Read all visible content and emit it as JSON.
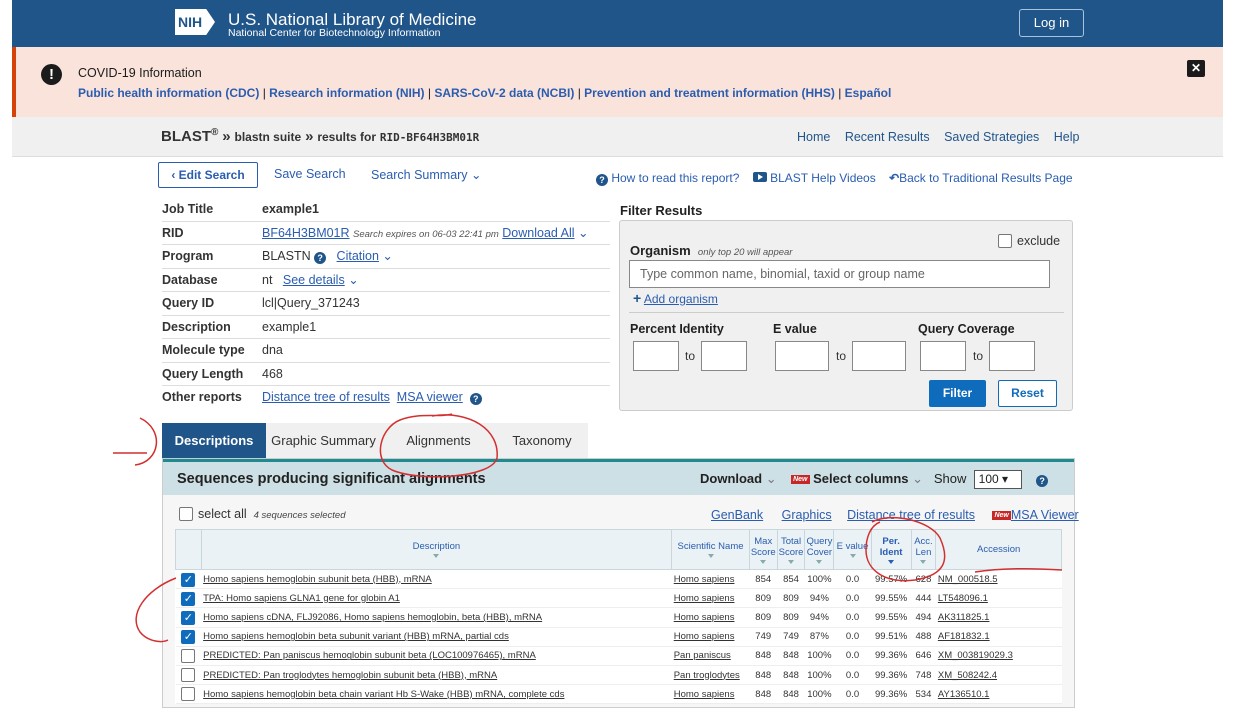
{
  "header": {
    "logo": "NIH",
    "title": "U.S. National Library of Medicine",
    "subtitle": "National Center for Biotechnology Information",
    "login": "Log in"
  },
  "covid": {
    "title": "COVID-19 Information",
    "links": [
      "Public health information (CDC)",
      "Research information (NIH)",
      "SARS-CoV-2 data (NCBI)",
      "Prevention and treatment information (HHS)",
      "Español"
    ],
    "sep": "|"
  },
  "breadcrumb": {
    "blast": "BLAST",
    "reg": "®",
    "sep1": "»",
    "suite": "blastn suite",
    "sep2": "»",
    "results_for": "results for",
    "rid": "RID-BF64H3BM01R"
  },
  "topnav": [
    "Home",
    "Recent Results",
    "Saved Strategies",
    "Help"
  ],
  "toolbar": {
    "edit": "‹ Edit Search",
    "save": "Save Search",
    "summary": "Search Summary",
    "how": "How to read this report?",
    "videos": "BLAST Help Videos",
    "back": "Back to Traditional Results Page"
  },
  "job": {
    "rows": [
      {
        "k": "Job Title",
        "v": "example1"
      },
      {
        "k": "RID",
        "v": "BF64H3BM01R",
        "note": "Search expires on 06-03 22:41 pm",
        "dl": "Download All"
      },
      {
        "k": "Program",
        "v": "BLASTN",
        "extra": "Citation"
      },
      {
        "k": "Database",
        "v": "nt",
        "extra": "See details"
      },
      {
        "k": "Query ID",
        "v": "lcl|Query_371243"
      },
      {
        "k": "Description",
        "v": "example1"
      },
      {
        "k": "Molecule type",
        "v": "dna"
      },
      {
        "k": "Query Length",
        "v": "468"
      },
      {
        "k": "Other reports",
        "v": "Distance tree of results",
        "extra": "MSA viewer"
      }
    ]
  },
  "filter": {
    "title": "Filter Results",
    "organism": "Organism",
    "note": "only top 20 will appear",
    "exclude": "exclude",
    "placeholder": "Type common  name, binomial, taxid or group  name",
    "add": "Add organism",
    "pct": "Percent Identity",
    "evalue": "E value",
    "qcov": "Query Coverage",
    "to": "to",
    "filter_btn": "Filter",
    "reset_btn": "Reset"
  },
  "tabs": [
    "Descriptions",
    "Graphic Summary",
    "Alignments",
    "Taxonomy"
  ],
  "results": {
    "title": "Sequences producing significant alignments",
    "download": "Download",
    "select_cols": "Select columns",
    "show": "Show",
    "show_val": "100",
    "new_badge": "New",
    "select_all": "select all",
    "selected": "4 sequences selected",
    "links": [
      "GenBank",
      "Graphics",
      "Distance tree of results",
      "MSA Viewer"
    ]
  },
  "columns": [
    "Description",
    "Scientific Name",
    "Max Score",
    "Total Score",
    "Query Cover",
    "E value",
    "Per. Ident",
    "Acc. Len",
    "Accession"
  ],
  "rows": [
    {
      "checked": true,
      "desc": "Homo sapiens hemoglobin subunit beta (HBB), mRNA",
      "sci": "Homo sapiens",
      "max": "854",
      "total": "854",
      "cover": "100%",
      "e": "0.0",
      "ident": "99.57%",
      "len": "628",
      "acc": "NM_000518.5"
    },
    {
      "checked": true,
      "desc": "TPA: Homo sapiens GLNA1 gene for globin A1",
      "sci": "Homo sapiens",
      "max": "809",
      "total": "809",
      "cover": "94%",
      "e": "0.0",
      "ident": "99.55%",
      "len": "444",
      "acc": "LT548096.1"
    },
    {
      "checked": true,
      "desc": "Homo sapiens cDNA, FLJ92086, Homo sapiens hemoglobin, beta (HBB), mRNA",
      "sci": "Homo sapiens",
      "max": "809",
      "total": "809",
      "cover": "94%",
      "e": "0.0",
      "ident": "99.55%",
      "len": "494",
      "acc": "AK311825.1"
    },
    {
      "checked": true,
      "desc": "Homo sapiens hemoglobin beta subunit variant (HBB) mRNA, partial cds",
      "sci": "Homo sapiens",
      "max": "749",
      "total": "749",
      "cover": "87%",
      "e": "0.0",
      "ident": "99.51%",
      "len": "488",
      "acc": "AF181832.1"
    },
    {
      "checked": false,
      "desc": "PREDICTED: Pan paniscus hemoglobin subunit beta (LOC100976465), mRNA",
      "sci": "Pan paniscus",
      "max": "848",
      "total": "848",
      "cover": "100%",
      "e": "0.0",
      "ident": "99.36%",
      "len": "646",
      "acc": "XM_003819029.3"
    },
    {
      "checked": false,
      "desc": "PREDICTED: Pan troglodytes hemoglobin subunit beta (HBB), mRNA",
      "sci": "Pan troglodytes",
      "max": "848",
      "total": "848",
      "cover": "100%",
      "e": "0.0",
      "ident": "99.36%",
      "len": "748",
      "acc": "XM_508242.4"
    },
    {
      "checked": false,
      "desc": "Homo sapiens hemoglobin beta chain variant Hb S-Wake (HBB) mRNA, complete cds",
      "sci": "Homo sapiens",
      "max": "848",
      "total": "848",
      "cover": "100%",
      "e": "0.0",
      "ident": "99.36%",
      "len": "534",
      "acc": "AY136510.1"
    }
  ]
}
